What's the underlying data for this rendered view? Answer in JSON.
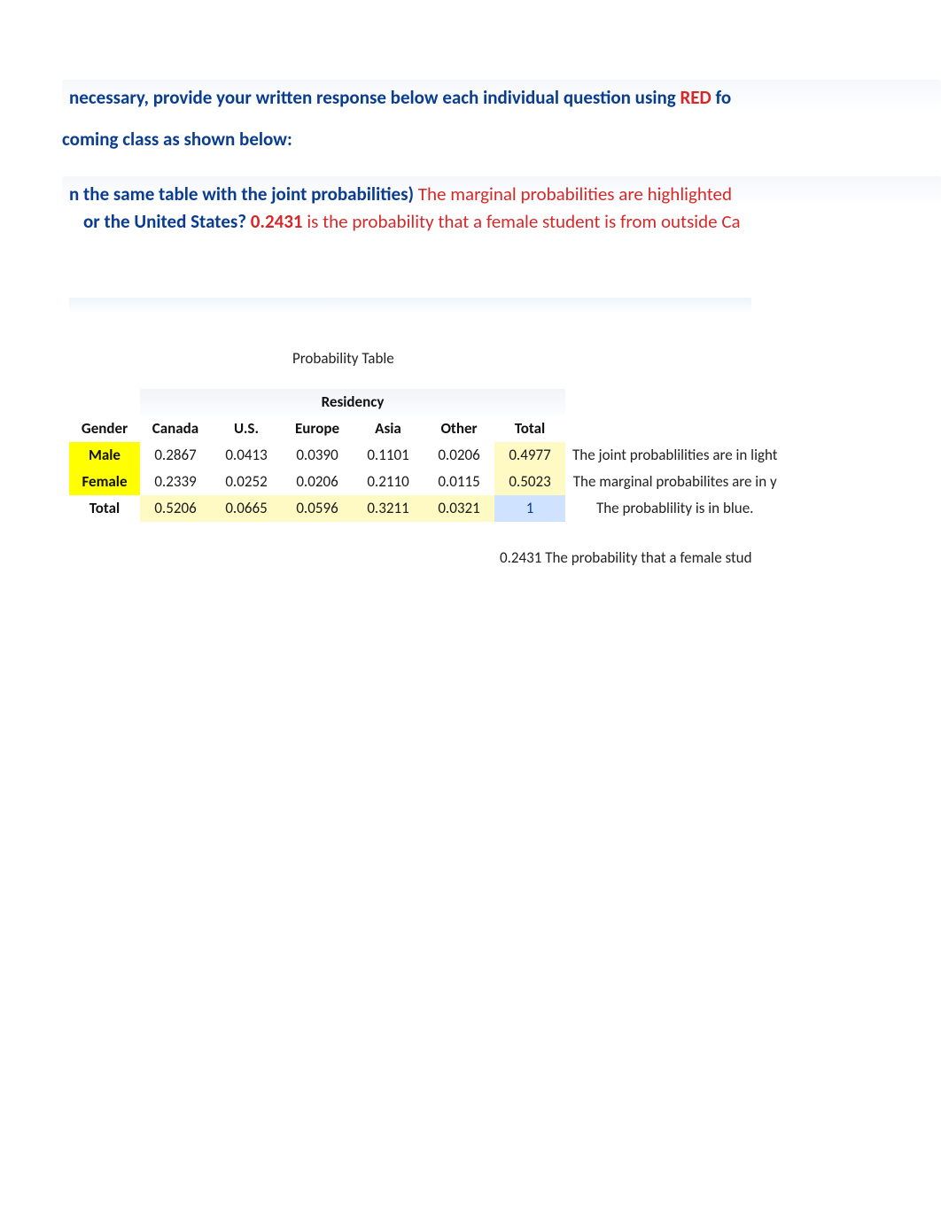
{
  "text": {
    "line1a": "necessary, provide your written response below each individual question using ",
    "line1b": "RED",
    "line1c": " fo",
    "line2": "coming class as shown below:",
    "line3a": "n the same table with the joint probabilities)",
    "line3b": "  The marginal probabilities are highlighted",
    "line4a": "or the United States?  ",
    "line4b": "0.2431",
    "line4c": " is the probability that a female student is from outside Ca"
  },
  "caption": "Probability Table",
  "headers": {
    "gender": "Gender",
    "residency": "Residency",
    "cols": [
      "Canada",
      "U.S.",
      "Europe",
      "Asia",
      "Other",
      "Total"
    ]
  },
  "rows": [
    {
      "label": "Male",
      "vals": [
        "0.2867",
        "0.0413",
        "0.0390",
        "0.1101",
        "0.0206"
      ],
      "total": "0.4977",
      "note": "The joint probablilities are in light"
    },
    {
      "label": "Female",
      "vals": [
        "0.2339",
        "0.0252",
        "0.0206",
        "0.2110",
        "0.0115"
      ],
      "total": "0.5023",
      "note": "The marginal probabilites are in y"
    }
  ],
  "totals": {
    "label": "Total",
    "vals": [
      "0.5206",
      "0.0665",
      "0.0596",
      "0.3211",
      "0.0321"
    ],
    "grand": "1",
    "note": "The probablility is in blue."
  },
  "below": {
    "val": "0.2431",
    "text": " The probability that a female stud"
  },
  "chart_data": {
    "type": "table",
    "title": "Probability Table",
    "row_headers": [
      "Male",
      "Female",
      "Total"
    ],
    "col_headers": [
      "Canada",
      "U.S.",
      "Europe",
      "Asia",
      "Other",
      "Total"
    ],
    "values": [
      [
        0.2867,
        0.0413,
        0.039,
        0.1101,
        0.0206,
        0.4977
      ],
      [
        0.2339,
        0.0252,
        0.0206,
        0.211,
        0.0115,
        0.5023
      ],
      [
        0.5206,
        0.0665,
        0.0596,
        0.3211,
        0.0321,
        1
      ]
    ]
  }
}
